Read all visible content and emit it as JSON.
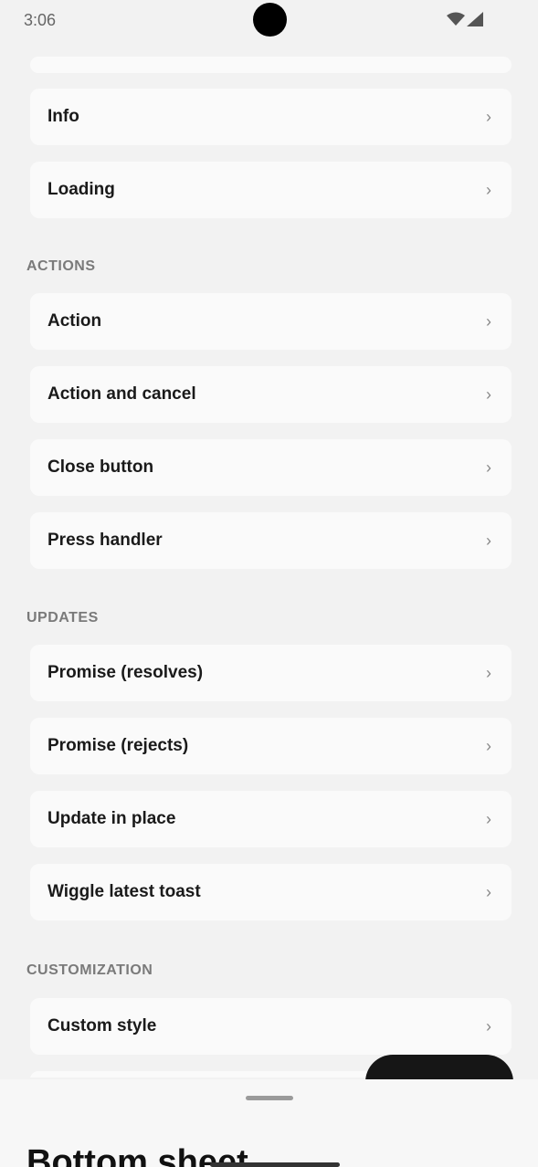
{
  "status_bar": {
    "time": "3:06"
  },
  "sections": {
    "top_items": [
      {
        "label": "Info",
        "chevron": "›"
      },
      {
        "label": "Loading",
        "chevron": "›"
      }
    ],
    "actions": {
      "header": "ACTIONS",
      "items": [
        {
          "label": "Action",
          "chevron": "›"
        },
        {
          "label": "Action and cancel",
          "chevron": "›"
        },
        {
          "label": "Close button",
          "chevron": "›"
        },
        {
          "label": "Press handler",
          "chevron": "›"
        }
      ]
    },
    "updates": {
      "header": "UPDATES",
      "items": [
        {
          "label": "Promise (resolves)",
          "chevron": "›"
        },
        {
          "label": "Promise (rejects)",
          "chevron": "›"
        },
        {
          "label": "Update in place",
          "chevron": "›"
        },
        {
          "label": "Wiggle latest toast",
          "chevron": "›"
        }
      ]
    },
    "customization": {
      "header": "CUSTOMIZATION",
      "items": [
        {
          "label": "Custom style",
          "chevron": "›"
        }
      ]
    }
  },
  "bottom_sheet": {
    "title": "Bottom sheet"
  },
  "icons": {
    "wifi": "wifi-icon",
    "signal": "signal-icon",
    "chevron": "chevron-right-icon"
  }
}
